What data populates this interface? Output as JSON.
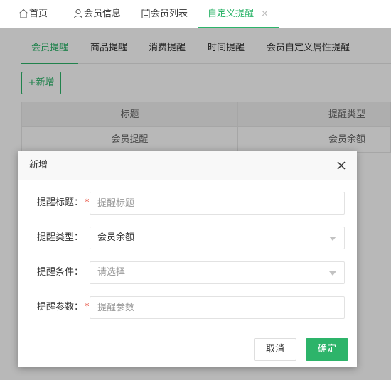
{
  "top_tabs": [
    {
      "label": "首页",
      "icon": "home-icon"
    },
    {
      "label": "会员信息",
      "icon": "user-icon"
    },
    {
      "label": "会员列表",
      "icon": "clipboard-icon"
    },
    {
      "label": "自定义提醒",
      "active": true,
      "close": "×"
    }
  ],
  "sub_tabs": [
    {
      "label": "会员提醒",
      "active": true
    },
    {
      "label": "商品提醒"
    },
    {
      "label": "消费提醒"
    },
    {
      "label": "时间提醒"
    },
    {
      "label": "会员自定义属性提醒"
    }
  ],
  "toolbar": {
    "add_label": "+新增"
  },
  "table": {
    "columns": [
      "标题",
      "提醒类型"
    ],
    "rows": [
      [
        "会员提醒",
        "会员余额"
      ]
    ]
  },
  "modal": {
    "title": "新增",
    "fields": [
      {
        "label": "提醒标题：",
        "required": true,
        "value": "",
        "placeholder": "提醒标题",
        "type": "input"
      },
      {
        "label": "提醒类型：",
        "required": false,
        "value": "会员余额",
        "type": "select"
      },
      {
        "label": "提醒条件：",
        "required": false,
        "value": "请选择",
        "type": "select",
        "is_placeholder": true
      },
      {
        "label": "提醒参数：",
        "required": true,
        "value": "",
        "placeholder": "提醒参数",
        "type": "input"
      }
    ],
    "required_mark": "*",
    "cancel_label": "取消",
    "ok_label": "确定"
  },
  "colors": {
    "accent": "#2db46a",
    "required": "#e74c3c"
  }
}
